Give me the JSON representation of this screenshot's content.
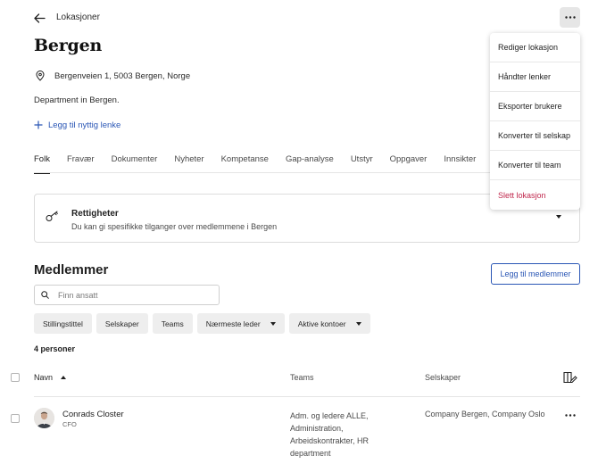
{
  "header": {
    "breadcrumb": "Lokasjoner",
    "title": "Bergen"
  },
  "location": {
    "address": "Bergenveien 1, 5003 Bergen, Norge",
    "description": "Department in Bergen.",
    "add_link_label": "Legg til nyttig lenke"
  },
  "tabs": [
    {
      "label": "Folk",
      "active": true
    },
    {
      "label": "Fravær"
    },
    {
      "label": "Dokumenter"
    },
    {
      "label": "Nyheter"
    },
    {
      "label": "Kompetanse"
    },
    {
      "label": "Gap-analyse"
    },
    {
      "label": "Utstyr"
    },
    {
      "label": "Oppgaver"
    },
    {
      "label": "Innsikter"
    }
  ],
  "permissions": {
    "title": "Rettigheter",
    "subtitle": "Du kan gi spesifikke tilganger over medlemmene i Bergen"
  },
  "members": {
    "title": "Medlemmer",
    "add_button": "Legg til medlemmer",
    "search_placeholder": "Finn ansatt",
    "filters": [
      {
        "label": "Stillingstittel"
      },
      {
        "label": "Selskaper"
      },
      {
        "label": "Teams"
      },
      {
        "label": "Nærmeste leder",
        "dropdown": true
      },
      {
        "label": "Aktive kontoer",
        "dropdown": true
      }
    ],
    "count": "4 personer",
    "columns": {
      "name": "Navn",
      "teams": "Teams",
      "companies": "Selskaper"
    },
    "rows": [
      {
        "name": "Conrads Closter",
        "role": "CFO",
        "teams": "Adm. og ledere ALLE, Administration, Arbeidskontrakter, HR department",
        "companies": "Company Bergen, Company Oslo"
      }
    ]
  },
  "menu": {
    "items": [
      {
        "label": "Rediger lokasjon"
      },
      {
        "label": "Håndter lenker"
      },
      {
        "label": "Eksporter brukere"
      },
      {
        "label": "Konverter til selskap"
      },
      {
        "label": "Konverter til team"
      },
      {
        "label": "Slett lokasjon",
        "danger": true
      }
    ]
  },
  "colors": {
    "accent": "#2a56b5",
    "danger": "#c0284d"
  },
  "icons": {
    "back": "arrow-left-icon",
    "more": "more-horizontal-icon",
    "pin": "location-pin-icon",
    "add": "plus-icon",
    "key": "key-icon",
    "search": "search-icon",
    "columns": "columns-edit-icon"
  }
}
